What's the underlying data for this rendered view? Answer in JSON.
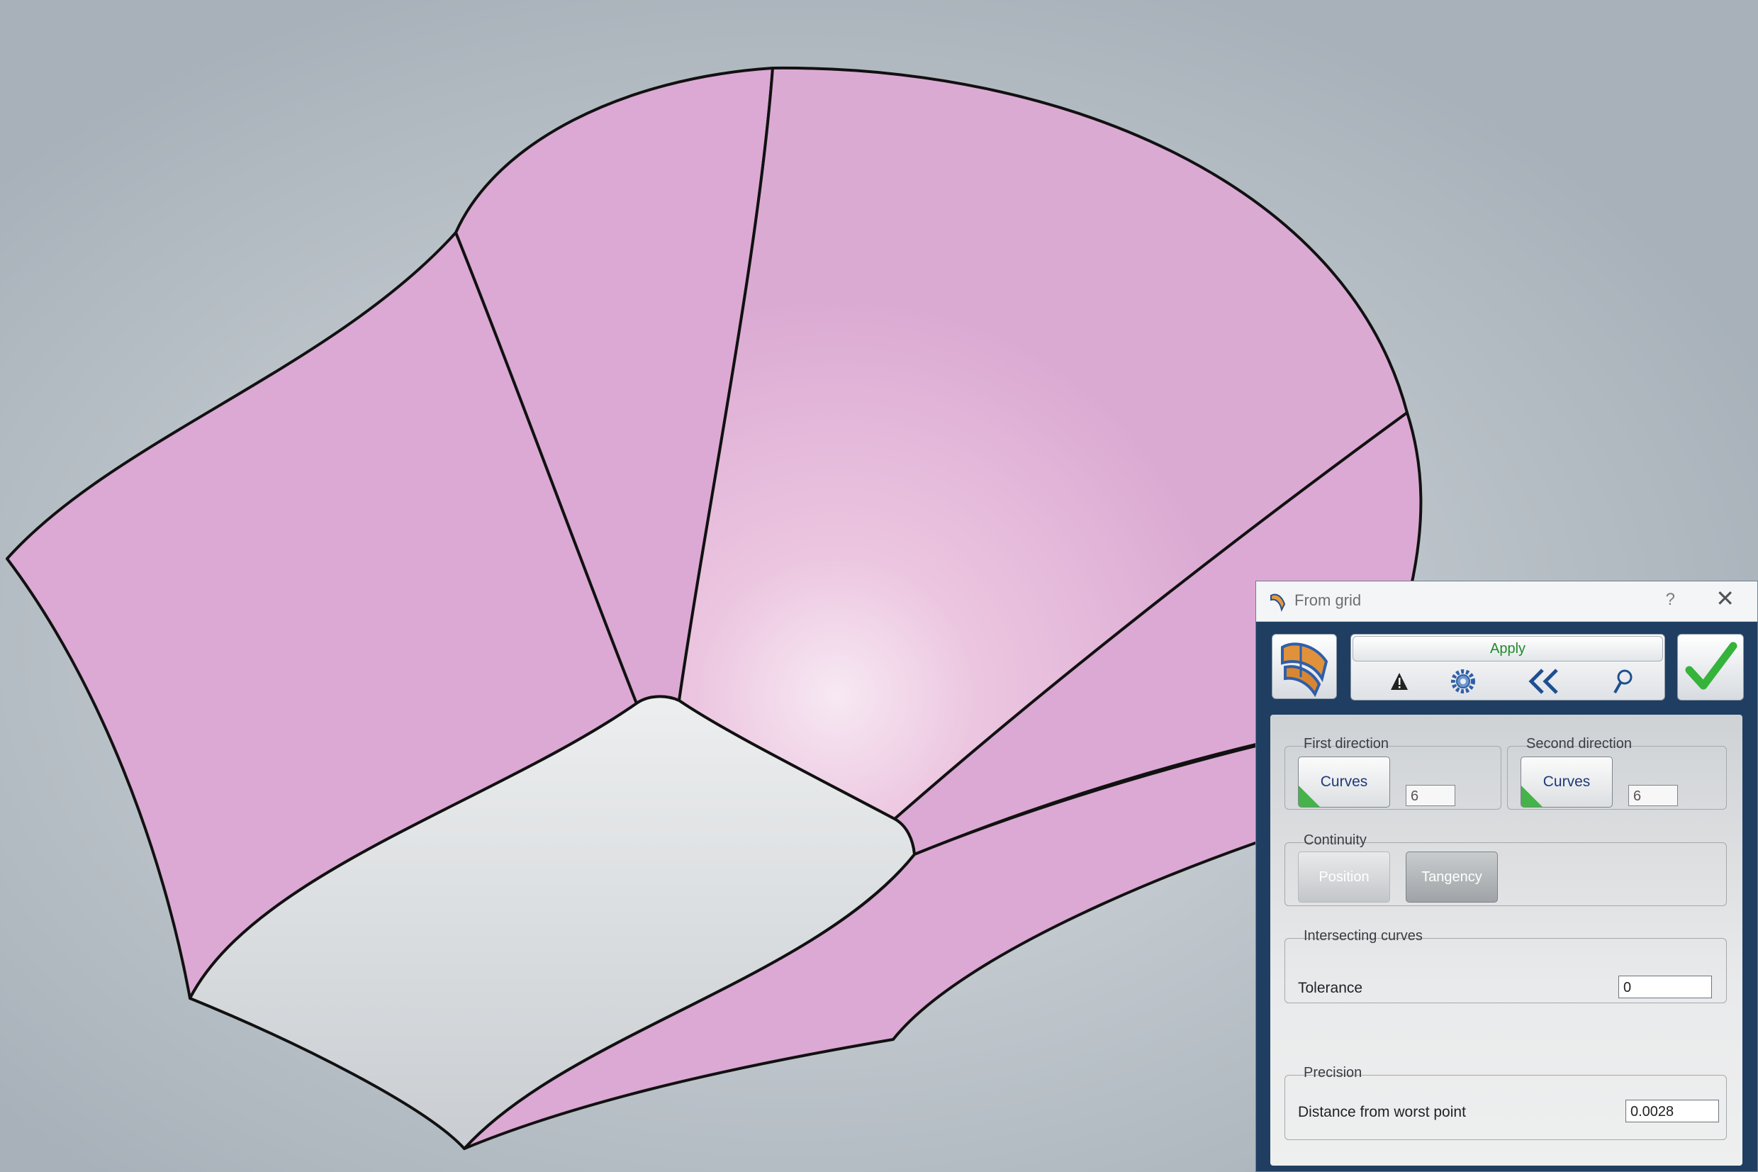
{
  "dialog": {
    "title": "From grid",
    "help": "?",
    "close": "✕",
    "apply_label": "Apply",
    "tools": [
      "warning-icon",
      "settings-gear-icon",
      "collapse-chevron-icon",
      "search-magnifier-icon"
    ],
    "first_direction": {
      "label": "First direction",
      "button": "Curves",
      "count": "6"
    },
    "second_direction": {
      "label": "Second direction",
      "button": "Curves",
      "count": "6"
    },
    "continuity": {
      "label": "Continuity",
      "position": "Position",
      "tangency": "Tangency"
    },
    "intersecting": {
      "label": "Intersecting curves",
      "tolerance_label": "Tolerance",
      "tolerance_value": "0"
    },
    "precision": {
      "label": "Precision",
      "distance_label": "Distance from worst point",
      "distance_value": "0.0028"
    }
  },
  "colors": {
    "surface_pink": "#dbaad3",
    "surface_highlight": "#f5e6f1",
    "surface_gray": "#d2d5d9",
    "dialog_frame": "#1f3e62",
    "apply_green": "#1f8a2b",
    "check_green": "#35b33a",
    "curves_text": "#1d3a78"
  }
}
